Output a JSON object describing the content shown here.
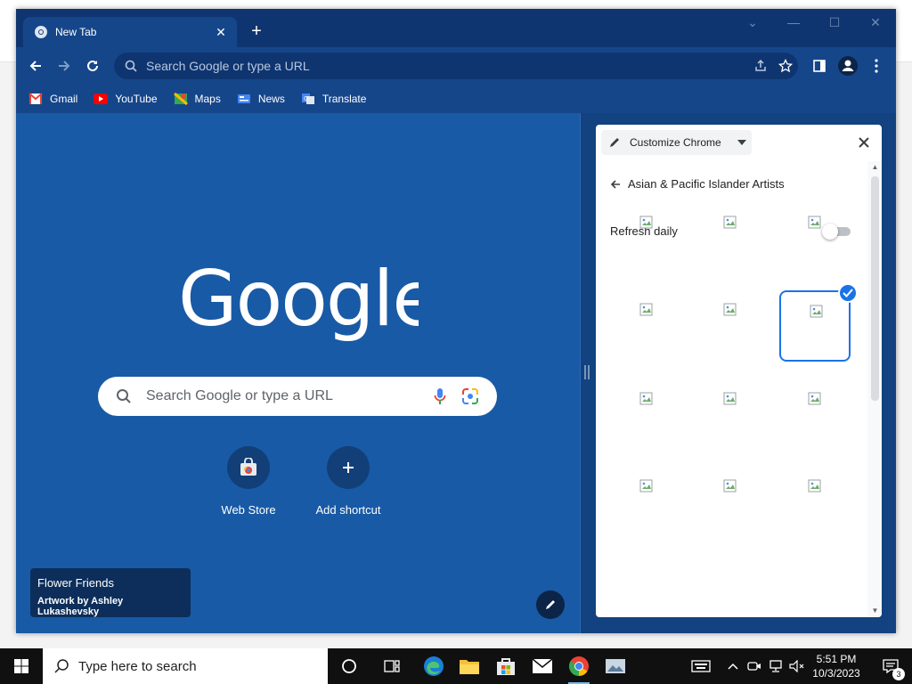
{
  "window": {
    "tab": {
      "title": "New Tab",
      "close_icon": "close-icon"
    },
    "new_tab_icon": "plus-icon",
    "controls": [
      "chevron-down-icon",
      "minimize-icon",
      "maximize-icon",
      "close-icon"
    ]
  },
  "toolbar": {
    "omnibox_placeholder": "Search Google or type a URL",
    "icons": [
      "back-arrow-icon",
      "forward-arrow-icon",
      "reload-icon",
      "search-icon",
      "share-icon",
      "bookmark-star-icon",
      "side-panel-icon",
      "profile-icon",
      "more-vert-icon"
    ]
  },
  "bookmarks": [
    {
      "label": "Gmail",
      "icon": "gmail-icon",
      "color": "#ea4335"
    },
    {
      "label": "YouTube",
      "icon": "youtube-icon",
      "color": "#ff0000"
    },
    {
      "label": "Maps",
      "icon": "maps-icon",
      "color": "#34a853"
    },
    {
      "label": "News",
      "icon": "news-icon",
      "color": "#4285f4"
    },
    {
      "label": "Translate",
      "icon": "translate-icon",
      "color": "#4285f4"
    }
  ],
  "ntp": {
    "logo_text": "Google",
    "search_placeholder": "Search Google or type a URL",
    "shortcuts": [
      {
        "label": "Web Store",
        "icon": "web-store-icon"
      },
      {
        "label": "Add shortcut",
        "icon": "plus-icon"
      }
    ],
    "attribution": {
      "title": "Flower Friends",
      "byline": "Artwork by Ashley Lukashevsky"
    },
    "background_color": "#185aa5"
  },
  "side_panel": {
    "dropdown_label": "Customize Chrome",
    "collection_title": "Asian & Pacific Islander Artists",
    "refresh_label": "Refresh daily",
    "refresh_on": false,
    "tiles_count": 12,
    "selected_tile": 6,
    "accent_color": "#1a73e8"
  },
  "taskbar": {
    "search_placeholder": "Type here to search",
    "time": "5:51 PM",
    "date": "10/3/2023",
    "notification_count": "3",
    "apps": [
      "task-view-icon",
      "widgets-icon",
      "edge-icon",
      "file-explorer-icon",
      "store-icon",
      "mail-icon",
      "chrome-icon",
      "photos-icon"
    ]
  }
}
